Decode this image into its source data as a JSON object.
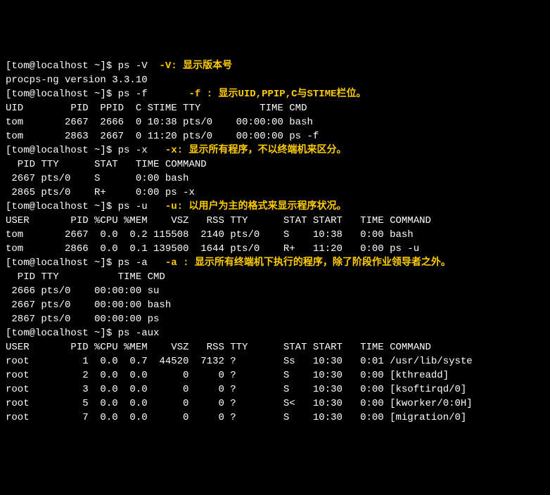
{
  "prompt": "[tom@localhost ~]$ ",
  "cmds": {
    "psV": "ps -V",
    "psf": "ps -f",
    "psx": "ps -x",
    "psu": "ps -u",
    "psa": "ps -a",
    "psaux": "ps -aux"
  },
  "annos": {
    "V": "-V: 显示版本号",
    "f": "-f : 显示UID,PPIP,C与STIME栏位。",
    "x": "-x: 显示所有程序，不以终端机来区分。",
    "u": "-u: 以用户为主的格式来显示程序状况。",
    "a": "-a : 显示所有终端机下执行的程序，除了阶段作业领导者之外。"
  },
  "ver": "procps-ng version 3.3.10",
  "f": {
    "hdr": "UID        PID  PPID  C STIME TTY          TIME CMD",
    "r1": "tom       2667  2666  0 10:38 pts/0    00:00:00 bash",
    "r2": "tom       2863  2667  0 11:20 pts/0    00:00:00 ps -f"
  },
  "x": {
    "hdr": "  PID TTY      STAT   TIME COMMAND",
    "r1": " 2667 pts/0    S      0:00 bash",
    "r2": " 2865 pts/0    R+     0:00 ps -x"
  },
  "u": {
    "hdr": "USER       PID %CPU %MEM    VSZ   RSS TTY      STAT START   TIME COMMAND",
    "r1": "tom       2667  0.0  0.2 115508  2140 pts/0    S    10:38   0:00 bash",
    "r2": "tom       2866  0.0  0.1 139500  1644 pts/0    R+   11:20   0:00 ps -u"
  },
  "a": {
    "hdr": "  PID TTY          TIME CMD",
    "r1": " 2666 pts/0    00:00:00 su",
    "r2": " 2667 pts/0    00:00:00 bash",
    "r3": " 2867 pts/0    00:00:00 ps"
  },
  "aux": {
    "hdr": "USER       PID %CPU %MEM    VSZ   RSS TTY      STAT START   TIME COMMAND",
    "r1": "root         1  0.0  0.7  44520  7132 ?        Ss   10:30   0:01 /usr/lib/syste",
    "r2": "root         2  0.0  0.0      0     0 ?        S    10:30   0:00 [kthreadd]",
    "r3": "root         3  0.0  0.0      0     0 ?        S    10:30   0:00 [ksoftirqd/0]",
    "r4": "root         5  0.0  0.0      0     0 ?        S<   10:30   0:00 [kworker/0:0H]",
    "r5": "root         7  0.0  0.0      0     0 ?        S    10:30   0:00 [migration/0]"
  }
}
